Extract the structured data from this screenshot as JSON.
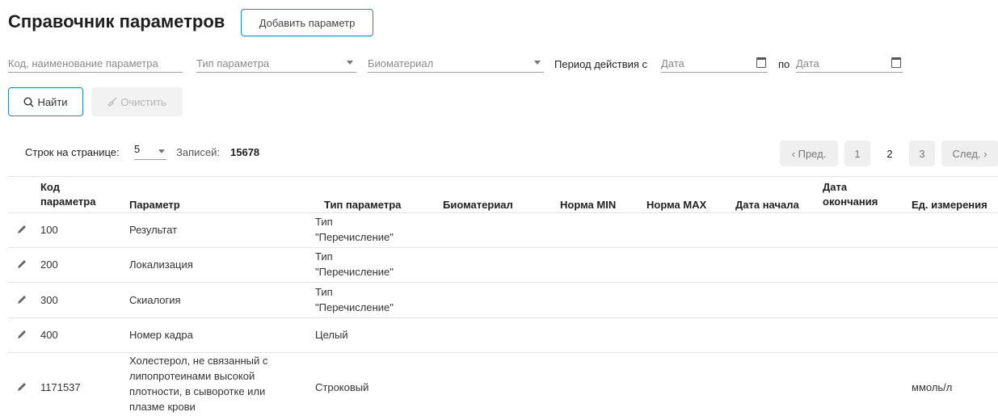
{
  "header": {
    "title": "Справочник параметров",
    "add_button": "Добавить параметр"
  },
  "filters": {
    "code_placeholder": "Код, наименование параметра",
    "type_placeholder": "Тип параметра",
    "biomaterial_placeholder": "Биоматериал",
    "period_label": "Период действия с",
    "date_from_placeholder": "Дата",
    "to_label": "по",
    "date_to_placeholder": "Дата",
    "find_button": "Найти",
    "clear_button": "Очистить"
  },
  "pagination": {
    "rows_label": "Строк на странице:",
    "rows_value": "5",
    "records_label": "Записей:",
    "records_value": "15678",
    "prev": "‹ Пред.",
    "pages": [
      "1",
      "2",
      "3"
    ],
    "next": "След. ›",
    "current_page": "2"
  },
  "table": {
    "headers": {
      "code_line1": "Код",
      "code_line2": "параметра",
      "param": "Параметр",
      "type": "Тип параметра",
      "biomaterial": "Биоматериал",
      "norm_min": "Норма MIN",
      "norm_max": "Норма MAX",
      "date_start": "Дата начала",
      "date_end_line1": "Дата",
      "date_end_line2": "окончания",
      "unit": "Ед. измерения"
    },
    "rows": [
      {
        "code": "100",
        "param": "Результат",
        "type_line1": "Тип",
        "type_line2": "\"Перечисление\"",
        "unit": ""
      },
      {
        "code": "200",
        "param": "Локализация",
        "type_line1": "Тип",
        "type_line2": "\"Перечисление\"",
        "unit": ""
      },
      {
        "code": "300",
        "param": "Скиалогия",
        "type_line1": "Тип",
        "type_line2": "\"Перечисление\"",
        "unit": ""
      },
      {
        "code": "400",
        "param": "Номер кадра",
        "type_line1": "Целый",
        "type_line2": "",
        "unit": ""
      },
      {
        "code": "1171537",
        "param_lines": [
          "Холестерол, не связанный с",
          "липопротеинами высокой",
          "плотности, в сыворотке или",
          "плазме крови"
        ],
        "type_line1": "Строковый",
        "type_line2": "",
        "unit": "ммоль/л"
      }
    ]
  }
}
